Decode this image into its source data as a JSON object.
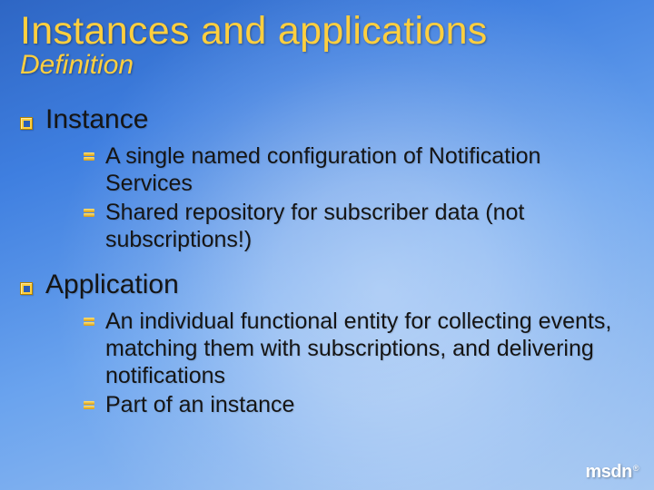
{
  "title": "Instances and applications",
  "subtitle": "Definition",
  "sections": [
    {
      "heading": "Instance",
      "items": [
        "A single named configuration of Notification Services",
        "Shared repository for subscriber data (not subscriptions!)"
      ]
    },
    {
      "heading": "Application",
      "items": [
        "An individual functional entity for collecting events, matching them with subscriptions, and delivering notifications",
        "Part of an instance"
      ]
    }
  ],
  "footer": {
    "logo_text": "msdn"
  }
}
